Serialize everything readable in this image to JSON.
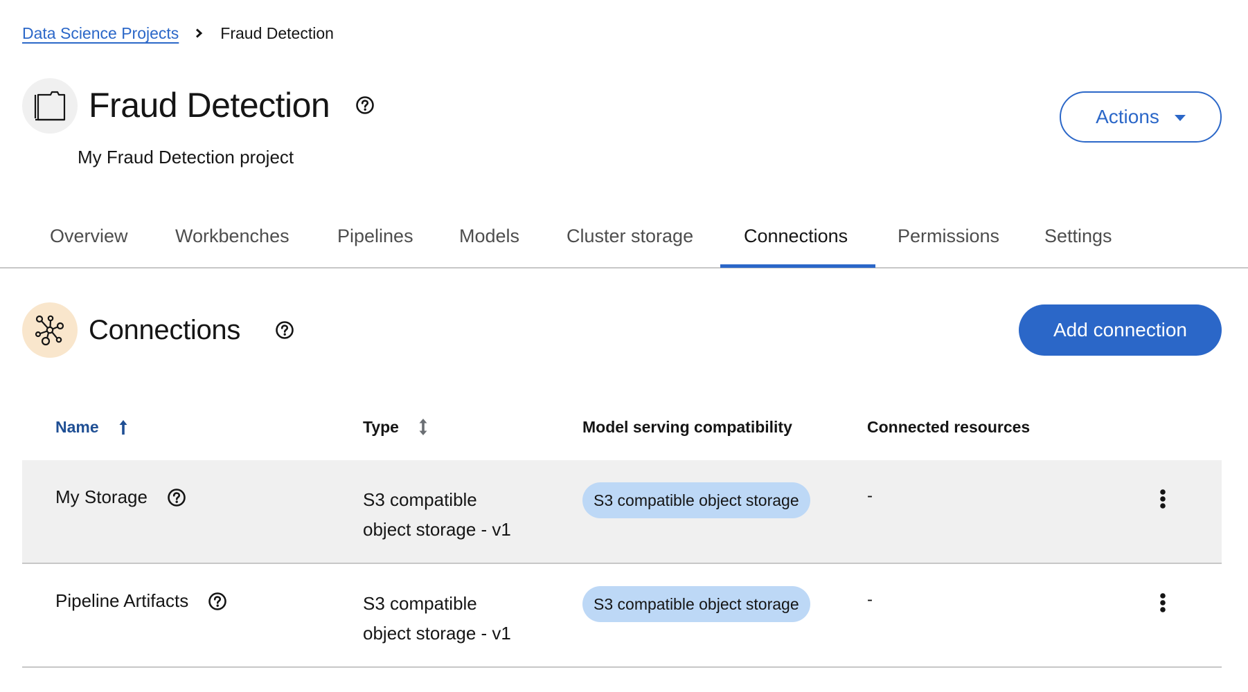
{
  "breadcrumb": {
    "parent_label": "Data Science Projects",
    "current_label": "Fraud Detection"
  },
  "project": {
    "icon": "project-folder-icon",
    "title": "Fraud Detection",
    "description": "My Fraud Detection project",
    "actions_label": "Actions"
  },
  "tabs": [
    {
      "label": "Overview",
      "active": false
    },
    {
      "label": "Workbenches",
      "active": false
    },
    {
      "label": "Pipelines",
      "active": false
    },
    {
      "label": "Models",
      "active": false
    },
    {
      "label": "Cluster storage",
      "active": false
    },
    {
      "label": "Connections",
      "active": true
    },
    {
      "label": "Permissions",
      "active": false
    },
    {
      "label": "Settings",
      "active": false
    }
  ],
  "section": {
    "icon": "connections-network-icon",
    "title": "Connections",
    "add_button_label": "Add connection"
  },
  "table": {
    "columns": [
      {
        "label": "Name",
        "sort": "ascending"
      },
      {
        "label": "Type",
        "sort": "sortable"
      },
      {
        "label": "Model serving compatibility",
        "sort": "none"
      },
      {
        "label": "Connected resources",
        "sort": "none"
      }
    ],
    "rows": [
      {
        "name": "My Storage",
        "type_line1": "S3 compatible",
        "type_line2": "object storage - v1",
        "compatibility": "S3 compatible object storage",
        "connected_resources": "-",
        "hovered": true
      },
      {
        "name": "Pipeline Artifacts",
        "type_line1": "S3 compatible",
        "type_line2": "object storage - v1",
        "compatibility": "S3 compatible object storage",
        "connected_resources": "-",
        "hovered": false
      }
    ]
  },
  "colors": {
    "primary": "#2b67c8",
    "sorted_header": "#1f4f94",
    "label_pill": "#bdd8f6",
    "section_icon_bg": "#f9e6cc",
    "project_icon_bg": "#f0f0f0",
    "row_hover": "#f0f0f0"
  }
}
